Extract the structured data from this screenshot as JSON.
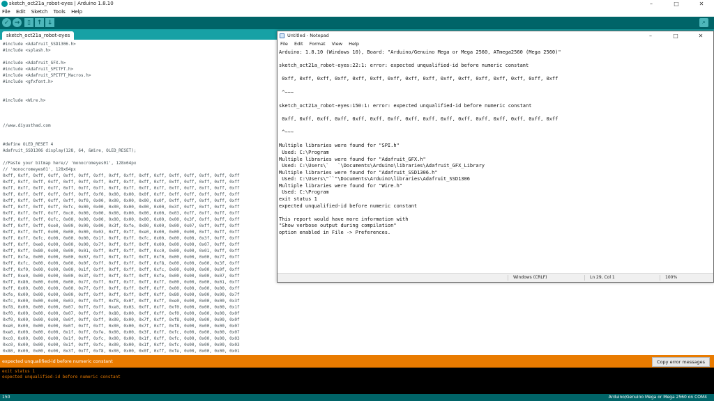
{
  "arduino": {
    "title": "sketch_oct21a_robot-eyes | Arduino 1.8.10",
    "window_controls": [
      "–",
      "□",
      "✕"
    ],
    "menu": [
      "File",
      "Edit",
      "Sketch",
      "Tools",
      "Help"
    ],
    "toolbar": {
      "verify_icon": "check-icon",
      "upload_icon": "arrow-right-icon",
      "new_icon": "new-file-icon",
      "open_icon": "arrow-up-icon",
      "save_icon": "arrow-down-icon",
      "serial_monitor_icon": "magnifier-icon"
    },
    "tab_label": "sketch_oct21a_robot-eyes",
    "code": "#include <Adafruit_SSD1306.h>\n#include <splash.h>\n\n#include <Adafruit_GFX.h>\n#include <Adafruit_SPITFT.h>\n#include <Adafruit_SPITFT_Macros.h>\n#include <gfxfont.h>\n\n\n#include <Wire.h>\n\n\n\n//www.diyusthad.com\n\n\n#define OLED_RESET 4\nAdafruit_SSD1306 display(128, 64, &Wire, OLED_RESET);\n\n//Paste your bitmap here// 'monocromeyes01', 128x64px\n// 'monocromeyes01', 128x64px\n0xff, 0xff, 0xff, 0xff, 0xff, 0xff, 0xff, 0xff, 0xff, 0xff, 0xff, 0xff, 0xff, 0xff, 0xff, 0xff\n0xff, 0xff, 0xff, 0xff, 0xff, 0xff, 0xff, 0xff, 0xff, 0xff, 0xff, 0xff, 0xff, 0xff, 0xff, 0xff\n0xff, 0xff, 0xff, 0xff, 0xff, 0xff, 0xff, 0xff, 0xff, 0xff, 0xff, 0xff, 0xff, 0xff, 0xff, 0xff\n0xff, 0xff, 0xff, 0xff, 0xff, 0xff, 0xf0, 0x00, 0x00, 0x0f, 0xff, 0xff, 0xff, 0xff, 0xff, 0xff\n0xff, 0xff, 0xff, 0xff, 0xff, 0xf0, 0x00, 0x00, 0x00, 0x00, 0x0f, 0xff, 0xff, 0xff, 0xff, 0xff\n0xff, 0xff, 0xff, 0xff, 0xfc, 0x00, 0x00, 0x00, 0x00, 0x00, 0x00, 0x3f, 0xff, 0xff, 0xff, 0xff\n0xff, 0xff, 0xff, 0xff, 0xc0, 0x00, 0x00, 0x00, 0x00, 0x00, 0x00, 0x03, 0xff, 0xff, 0xff, 0xff\n0xff, 0xff, 0xff, 0xfc, 0x00, 0x00, 0x00, 0x00, 0x00, 0x00, 0x00, 0x00, 0x3f, 0xff, 0xff, 0xff\n0xff, 0xff, 0xff, 0xe0, 0x00, 0x00, 0x00, 0x3f, 0xfe, 0x00, 0x00, 0x00, 0x07, 0xff, 0xff, 0xff\n0xff, 0xff, 0xff, 0x00, 0x00, 0x00, 0x03, 0xff, 0xff, 0xe0, 0x00, 0x00, 0x00, 0xff, 0xff, 0xff\n0xff, 0xff, 0xfc, 0x00, 0x00, 0x00, 0x1f, 0xff, 0xff, 0xfc, 0x00, 0x00, 0x00, 0x3f, 0xff, 0xff\n0xff, 0xff, 0xe0, 0x00, 0x00, 0x00, 0x7f, 0xff, 0xff, 0xff, 0x00, 0x00, 0x00, 0x07, 0xff, 0xff\n0xff, 0xff, 0x80, 0x00, 0x00, 0x01, 0xff, 0xff, 0xff, 0xff, 0xc0, 0x00, 0x00, 0x01, 0xff, 0xff\n0xff, 0xfe, 0x00, 0x00, 0x00, 0x07, 0xff, 0xff, 0xff, 0xff, 0xf0, 0x00, 0x00, 0x00, 0x7f, 0xff\n0xff, 0xfc, 0x00, 0x00, 0x00, 0x0f, 0xff, 0xff, 0xff, 0xff, 0xf8, 0x00, 0x00, 0x00, 0x3f, 0xff\n0xff, 0xf0, 0x00, 0x00, 0x00, 0x1f, 0xff, 0xff, 0xff, 0xff, 0xfc, 0x00, 0x00, 0x00, 0x0f, 0xff\n0xff, 0xe0, 0x00, 0x00, 0x00, 0x3f, 0xff, 0xff, 0xff, 0xff, 0xfe, 0x00, 0x00, 0x00, 0x07, 0xff\n0xff, 0x80, 0x00, 0x00, 0x00, 0x7f, 0xff, 0xff, 0xff, 0xff, 0xff, 0x00, 0x00, 0x00, 0x01, 0xff\n0xff, 0x00, 0x00, 0x00, 0x00, 0x7f, 0xff, 0xff, 0xff, 0xff, 0xff, 0x00, 0x00, 0x00, 0x00, 0xff\n0xfe, 0x00, 0x00, 0x00, 0x00, 0xff, 0xff, 0xff, 0xff, 0xff, 0xff, 0x80, 0x00, 0x00, 0x00, 0x7f\n0xfc, 0x00, 0x00, 0x00, 0x03, 0xff, 0xff, 0xf8, 0x0f, 0xff, 0xff, 0xe0, 0x00, 0x00, 0x00, 0x3f\n0xf8, 0x00, 0x00, 0x00, 0x07, 0xff, 0xff, 0xe0, 0x03, 0xff, 0xff, 0xf0, 0x00, 0x00, 0x00, 0x1f\n0xf0, 0x00, 0x00, 0x00, 0x07, 0xff, 0xff, 0x80, 0x00, 0xff, 0xff, 0xf0, 0x00, 0x00, 0x00, 0x0f\n0xf0, 0x00, 0x00, 0x00, 0x0f, 0xff, 0xff, 0x00, 0x00, 0x7f, 0xff, 0xf8, 0x00, 0x00, 0x00, 0x0f\n0xe0, 0x00, 0x00, 0x00, 0x0f, 0xff, 0xff, 0x00, 0x00, 0x7f, 0xff, 0xf8, 0x00, 0x00, 0x00, 0x07\n0xe0, 0x00, 0x00, 0x00, 0x1f, 0xff, 0xfe, 0x00, 0x00, 0x3f, 0xff, 0xfc, 0x00, 0x00, 0x00, 0x07\n0xc0, 0x00, 0x00, 0x00, 0x1f, 0xff, 0xfc, 0x00, 0x00, 0x1f, 0xff, 0xfc, 0x00, 0x00, 0x00, 0x03\n0xc0, 0x00, 0x00, 0x00, 0x1f, 0xff, 0xfc, 0x00, 0x00, 0x1f, 0xff, 0xfc, 0x00, 0x00, 0x00, 0x03\n0x80, 0x00, 0x00, 0x00, 0x3f, 0xff, 0xf8, 0x00, 0x00, 0x0f, 0xff, 0xfe, 0x00, 0x00, 0x00, 0x01",
    "message_bar": "expected unqualified-id before numeric constant",
    "copy_errors_label": "Copy error messages",
    "console": "exit status 1\nexpected unqualified-id before numeric constant",
    "status_line": "150",
    "status_board": "Arduino/Genuino Mega or Mega 2560 on COM4"
  },
  "notepad": {
    "title": "Untitled - Notepad",
    "window_controls": [
      "–",
      "□",
      "✕"
    ],
    "menu": [
      "File",
      "Edit",
      "Format",
      "View",
      "Help"
    ],
    "content": "Arduino: 1.8.10 (Windows 10), Board: \"Arduino/Genuino Mega or Mega 2560, ATmega2560 (Mega 2560)\"\n\nsketch_oct21a_robot-eyes:22:1: error: expected unqualified-id before numeric constant\n\n 0xff, 0xff, 0xff, 0xff, 0xff, 0xff, 0xff, 0xff, 0xff, 0xff, 0xff, 0xff, 0xff, 0xff, 0xff, 0xff\n\n ^~~~\n\nsketch_oct21a_robot-eyes:150:1: error: expected unqualified-id before numeric constant\n\n 0xff, 0xff, 0xff, 0xff, 0xff, 0xff, 0xff, 0xff, 0xff, 0xff, 0xff, 0xff, 0xff, 0xff, 0xff, 0xff\n\n ^~~~\n\nMultiple libraries were found for \"SPI.h\"\n Used: C:\\Program\nMultiple libraries were found for \"Adafruit_GFX.h\"\n Used: C:\\Users\\`   `\\Documents\\Arduino\\libraries\\Adafruit_GFX_Library\nMultiple libraries were found for \"Adafruit_SSD1306.h\"\n Used: C:\\Users\\\"``\"\\Documents\\Arduino\\libraries\\Adafruit_SSD1306\nMultiple libraries were found for \"Wire.h\"\n Used: C:\\Program\nexit status 1\nexpected unqualified-id before numeric constant\n\nThis report would have more information with\n\"Show verbose output during compilation\"\noption enabled in File -> Preferences.",
    "status_encoding": "Windows (CRLF)",
    "status_position": "Ln 29, Col 1",
    "status_zoom": "100%"
  }
}
